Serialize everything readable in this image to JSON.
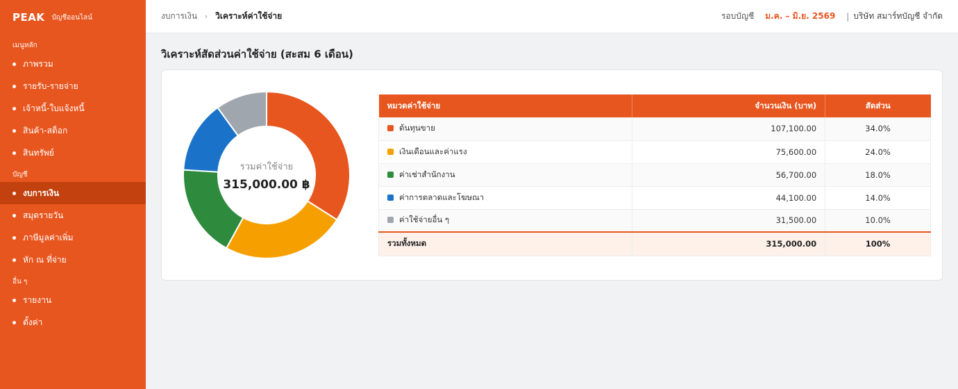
{
  "sidebar": {
    "brand": "PEAK",
    "brand_sub": "บัญชีออนไลน์",
    "sections": [
      {
        "label": "เมนูหลัก",
        "items": [
          {
            "id": "overview",
            "label": "ภาพรวม",
            "active": false
          },
          {
            "id": "income-expense",
            "label": "รายรับ-รายจ่าย",
            "active": false
          },
          {
            "id": "debtors-invoices",
            "label": "เจ้าหนี้-ใบแจ้งหนี้",
            "active": false
          },
          {
            "id": "products-stock",
            "label": "สินค้า-สต็อก",
            "active": false
          },
          {
            "id": "assets",
            "label": "สินทรัพย์",
            "active": false
          }
        ]
      },
      {
        "label": "บัญชี",
        "items": [
          {
            "id": "financial-statements",
            "label": "งบการเงิน",
            "active": true
          },
          {
            "id": "journal",
            "label": "สมุดรายวัน",
            "active": false
          },
          {
            "id": "vat",
            "label": "ภาษีมูลค่าเพิ่ม",
            "active": false
          },
          {
            "id": "withholding-tax",
            "label": "หัก ณ ที่จ่าย",
            "active": false
          }
        ]
      },
      {
        "label": "อื่น ๆ",
        "items": [
          {
            "id": "reports",
            "label": "รายงาน",
            "active": false
          },
          {
            "id": "settings",
            "label": "ตั้งค่า",
            "active": false
          }
        ]
      }
    ]
  },
  "header": {
    "breadcrumb_parent": "งบการเงิน",
    "breadcrumb_sep": "›",
    "breadcrumb_current": "วิเคราะห์ค่าใช้จ่าย",
    "period_label": "รอบบัญชี",
    "period_value": "ม.ค. – มิ.ย. 2569",
    "company_sep": "|",
    "company": "บริษัท สมาร์ทบัญชี จำกัด"
  },
  "page": {
    "title": "วิเคราะห์สัดส่วนค่าใช้จ่าย (สะสม 6 เดือน)"
  },
  "donut": {
    "center_label": "รวมค่าใช้จ่าย",
    "center_value": "315,000.00 ฿"
  },
  "table": {
    "headers": {
      "category": "หมวดค่าใช้จ่าย",
      "amount": "จำนวนเงิน (บาท)",
      "share": "สัดส่วน"
    },
    "rows": [
      {
        "category": "ต้นทุนขาย",
        "amount": "107,100.00",
        "share": "34.0%"
      },
      {
        "category": "เงินเดือนและค่าแรง",
        "amount": "75,600.00",
        "share": "24.0%"
      },
      {
        "category": "ค่าเช่าสำนักงาน",
        "amount": "56,700.00",
        "share": "18.0%"
      },
      {
        "category": "ค่าการตลาดและโฆษณา",
        "amount": "44,100.00",
        "share": "14.0%"
      },
      {
        "category": "ค่าใช้จ่ายอื่น ๆ",
        "amount": "31,500.00",
        "share": "10.0%"
      }
    ],
    "total": {
      "label": "รวมทั้งหมด",
      "amount": "315,000.00",
      "share": "100%"
    }
  },
  "chart_data": {
    "type": "pie",
    "categories": [
      "ต้นทุนขาย",
      "เงินเดือนและค่าแรง",
      "ค่าเช่าสำนักงาน",
      "ค่าการตลาดและโฆษณา",
      "ค่าใช้จ่ายอื่น ๆ"
    ],
    "values": [
      107100,
      75600,
      56700,
      44100,
      31500
    ],
    "colors": [
      "#e8561f",
      "#f5a000",
      "#2e8b3e",
      "#1a73c9",
      "#a0a6ad"
    ],
    "donut": true
  },
  "colors": {
    "accent": "#e8561f",
    "sidebar_active": "#c2410e"
  }
}
